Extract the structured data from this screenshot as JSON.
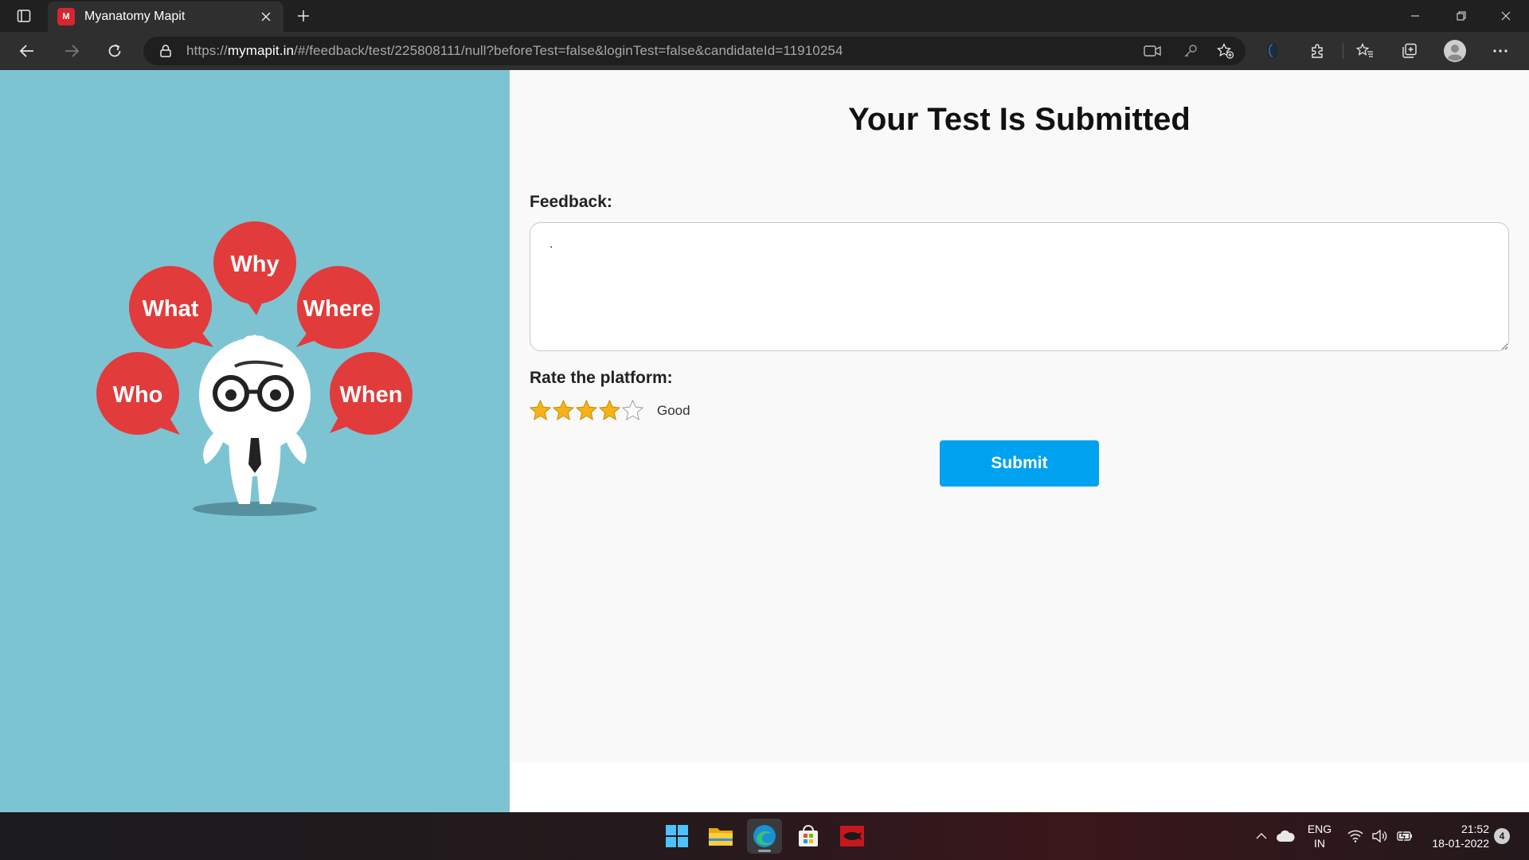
{
  "browser": {
    "tab": {
      "title": "Myanatomy Mapit",
      "favicon_text": "M"
    },
    "url": {
      "prefix": "https://",
      "domain": "mymapit.in",
      "path": "/#/feedback/test/225808111/null?beforeTest=false&loginTest=false&candidateId=11910254"
    },
    "icons": [
      "tab-actions-icon",
      "close-icon",
      "plus-icon",
      "minimize-icon",
      "restore-icon",
      "close-window-icon",
      "back-icon",
      "forward-icon",
      "refresh-icon",
      "lock-icon",
      "camera-icon",
      "key-icon",
      "add-favorite-icon",
      "extension-icon",
      "puzzle-icon",
      "favorites-icon",
      "collections-icon",
      "profile-icon",
      "more-icon"
    ]
  },
  "illustration": {
    "bubbles": [
      "Why",
      "What",
      "Where",
      "Who",
      "When"
    ],
    "bubble_color": "#e23b3b"
  },
  "page": {
    "heading": "Your Test Is Submitted",
    "feedback_label": "Feedback:",
    "feedback_value": ".",
    "rate_label": "Rate the platform:",
    "rating": {
      "value": 4,
      "max": 5,
      "text": "Good"
    },
    "submit_label": "Submit",
    "accent_color": "#00a2f0"
  },
  "taskbar": {
    "apps": [
      "windows-start-icon",
      "file-explorer-icon",
      "edge-icon",
      "store-icon",
      "app-icon"
    ],
    "lang_line1": "ENG",
    "lang_line2": "IN",
    "time": "21:52",
    "date": "18-01-2022",
    "notifications": "4"
  }
}
